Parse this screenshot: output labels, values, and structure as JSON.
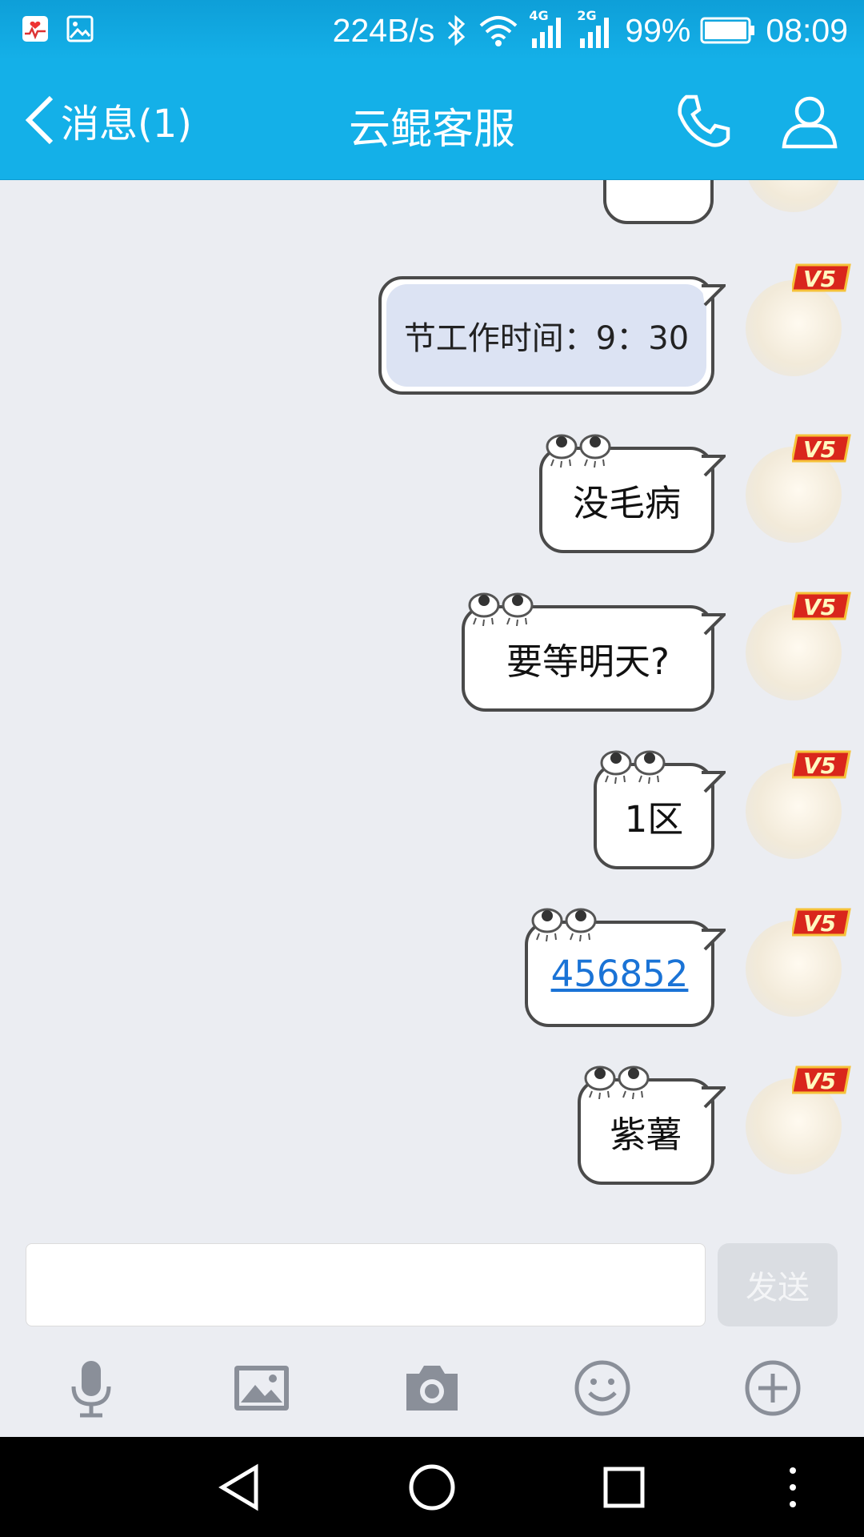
{
  "status_bar": {
    "speed": "224B/s",
    "net1": "4G",
    "net2": "2G",
    "battery": "99%",
    "time": "08:09",
    "icons": [
      "health-app-icon",
      "gallery-icon",
      "bluetooth-icon",
      "wifi-icon",
      "signal-icon",
      "battery-icon"
    ]
  },
  "header": {
    "back_label": "消息(1)",
    "title": "云鲲客服",
    "icons": [
      "chevron-left-icon",
      "phone-icon",
      "profile-icon"
    ]
  },
  "messages": [
    {
      "text": "...",
      "type": "partial"
    },
    {
      "text": "节工作时间：9：30",
      "type": "image"
    },
    {
      "text": "没毛病",
      "type": "text"
    },
    {
      "text": "要等明天?",
      "type": "text"
    },
    {
      "text": "1区",
      "type": "text"
    },
    {
      "text": "456852",
      "type": "link"
    },
    {
      "text": "紫薯",
      "type": "text"
    }
  ],
  "badge_label": "V5",
  "input": {
    "value": "",
    "placeholder": ""
  },
  "send_label": "发送",
  "toolbar": [
    "microphone-icon",
    "image-icon",
    "camera-icon",
    "emoji-icon",
    "plus-icon"
  ],
  "nav": [
    "back-triangle-icon",
    "home-circle-icon",
    "recents-square-icon",
    "more-dots-icon"
  ],
  "colors": {
    "accent": "#14b0e8",
    "link": "#1a73d6",
    "background": "#ebedf2"
  }
}
